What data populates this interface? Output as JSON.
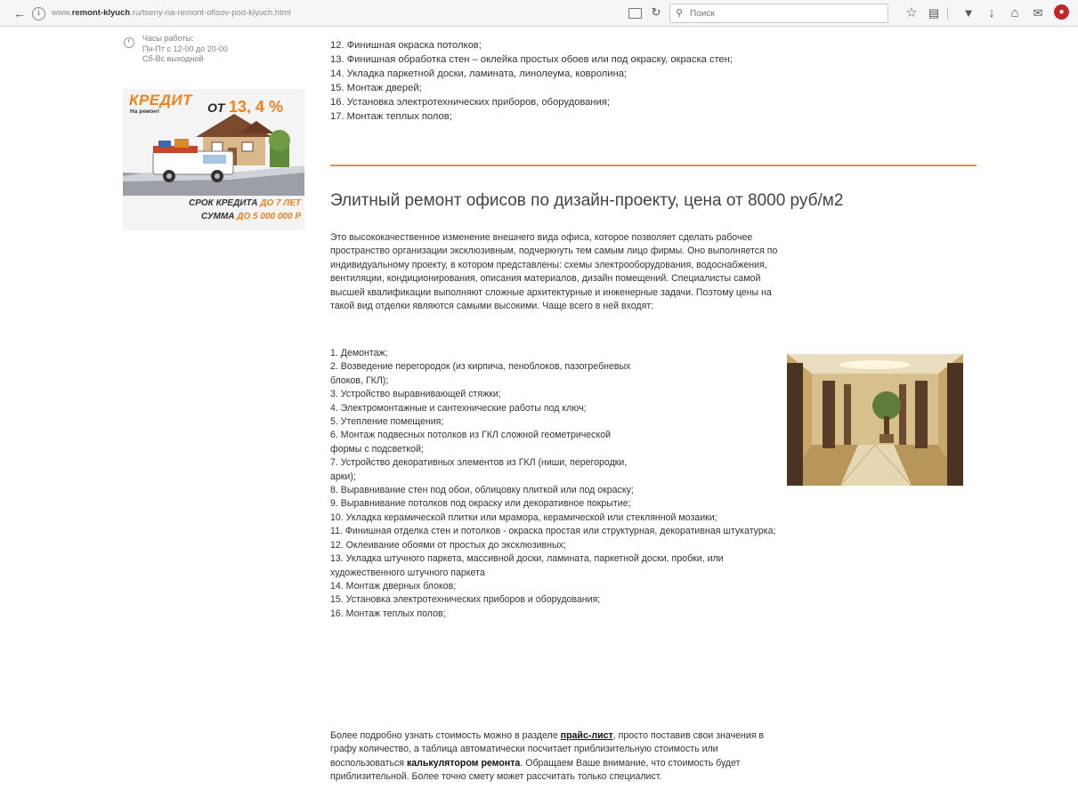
{
  "browser": {
    "url_prefix": "www.",
    "url_domain": "remont-klyuch",
    "url_path": ".ru/tseny-na-remont-ofisov-pod-klyuch.html",
    "search_placeholder": "Поиск"
  },
  "sidebar": {
    "hours_title": "Часы работы:",
    "hours_weekdays": "Пн-Пт с 12-00 до 20-00",
    "hours_weekend": "Сб-Вс выходной",
    "banner": {
      "title": "КРЕДИТ",
      "subtitle": "На ремонт квартиры",
      "from_label": "ОТ",
      "rate": "13, 4 %",
      "term_label": "СРОК КРЕДИТА",
      "term_value": "ДО 7 ЛЕТ",
      "sum_label": "СУММА",
      "sum_value": "ДО 5 000 000 Р"
    }
  },
  "top_list": [
    "12. Финишная окраска потолков;",
    "13. Финишная обработка стен – оклейка простых обоев или под окраску, окраска стен;",
    "14. Укладка паркетной доски, ламината, линолеума, ковролина;",
    "15. Монтаж дверей;",
    "16. Установка электротехнических приборов, оборудования;",
    "17. Монтаж теплых полов;"
  ],
  "section": {
    "heading": "Элитный ремонт офисов по дизайн-проекту, цена от 8000 руб/м2",
    "intro_lines": [
      "Это высококачественное изменение внешнего вида офиса, которое позволяет сделать рабочее",
      "пространство организации эксклюзивным, подчеркнуть тем самым лицо фирмы. Оно выполняется по",
      "индивидуальному проекту,  в котором представлены: схемы электрооборудования, водоснабжения,",
      "вентиляции, кондиционирования, описания материалов, дизайн помещений. Специалисты самой",
      "высшей квалификации выполняют сложные архитектурные и инженерные задачи. Поэтому цены на",
      "такой вид отделки являются самыми высокими. Чаще всего в ней входят:"
    ],
    "list_lines": [
      "1. Демонтаж;",
      "2. Возведение перегородок (из кирпича, пеноблоков, пазогребневых",
      "блоков, ГКЛ);",
      "3. Устройство выравнивающей стяжки;",
      "4. Электромонтажные и сантехнические работы под ключ;",
      "5. Утепление помещения;",
      "6. Монтаж подвесных потолков из ГКЛ сложной геометрической",
      "формы с подсветкой;",
      "7. Устройство декоративных элементов из ГКЛ (ниши, перегородки,",
      "арки);",
      "8. Выравнивание стен под обои, облицовку плиткой или под окраску;",
      "9. Выравнивание потолков под окраску или декоративное покрытие;",
      "10. Укладка керамической плитки или мрамора, керамической или стеклянной мозаики;",
      "11. Финишная отделка стен и потолков - окраска простая или структурная, декоративная штукатурка;",
      "12. Оклеивание обоями от простых до эксклюзивных;",
      "13. Укладка штучного паркета, массивной доски, ламината, паркетной доски, пробки, или",
      "художественного штучного паркета",
      "14. Монтаж дверных блоков;",
      "15. Установка электротехнических приборов и оборудования;",
      "16. Монтаж теплых полов;"
    ],
    "outro": {
      "line1_before": "Более подробно узнать стоимость можно в разделе ",
      "price_link": "прайс-лист",
      "line1_after": ", просто поставив свои значения в",
      "line2": "графу количество, а таблица автоматически посчитает приблизительную стоимость или",
      "line3_before": "воспользоваться ",
      "calc_link": "калькулятором ремонта",
      "line3_after": ". Обращаем Ваше внимание, что стоимость будет",
      "line4": "приблизительной. Более точно смету может рассчитать только специалист."
    }
  }
}
